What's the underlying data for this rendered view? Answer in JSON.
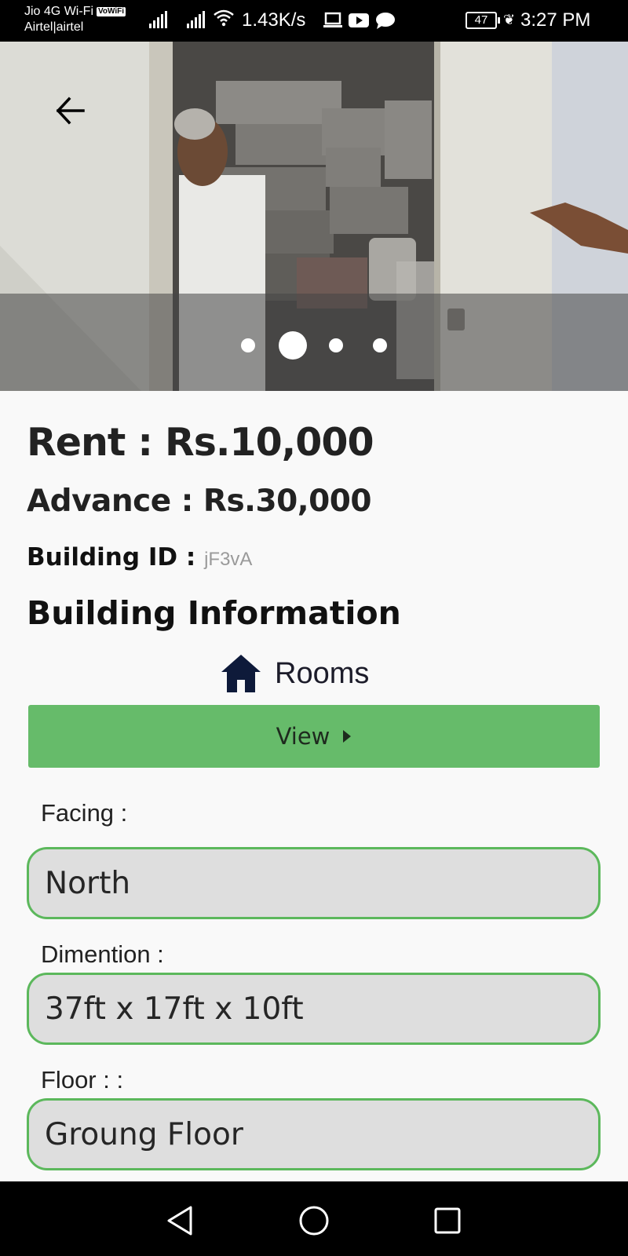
{
  "status_bar": {
    "carrier_line1": "Jio 4G Wi-Fi",
    "vowifi_badge": "VoWiFi",
    "carrier_line2": "Airtel|airtel",
    "net_speed": "1.43K/s",
    "battery": "47",
    "time": "3:27 PM"
  },
  "carousel": {
    "slide_count": 4,
    "active_index": 1
  },
  "listing": {
    "rent": "Rent : Rs.10,000",
    "advance": "Advance : Rs.30,000",
    "building_id_label": "Building ID : ",
    "building_id_value": "jF3vA",
    "section_title": "Building Information",
    "rooms_label": "Rooms",
    "view_button_label": "View"
  },
  "fields": {
    "facing_label": "Facing :",
    "facing_value": "North",
    "dimension_label": "Dimention :",
    "dimension_value": "37ft x 17ft x 10ft",
    "floor_label": "Floor :  :",
    "floor_value": "Groung Floor"
  },
  "colors": {
    "accent_green": "#66bb6a",
    "field_border": "#5cb85c",
    "rooms_icon": "#0e1a3a"
  },
  "icons": {
    "back": "arrow-left-icon",
    "rooms": "home-icon",
    "view": "caret-right-icon",
    "nav_back": "triangle-back-icon",
    "nav_home": "circle-home-icon",
    "nav_recents": "square-recents-icon"
  }
}
